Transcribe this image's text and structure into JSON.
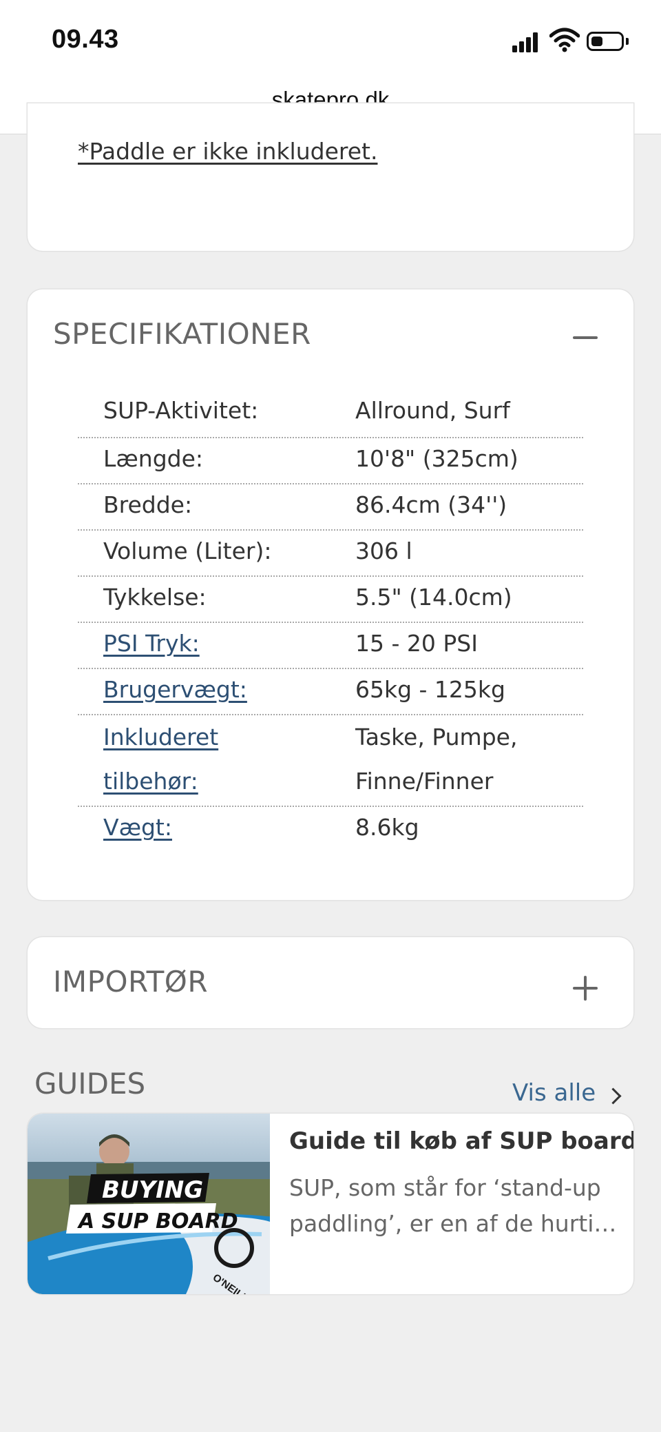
{
  "status_bar": {
    "time": "09.43"
  },
  "browser": {
    "url": "skatepro.dk"
  },
  "note": {
    "text": "*Paddle er ikke inkluderet."
  },
  "specs": {
    "title": "SPECIFIKATIONER",
    "rows": [
      {
        "label": "SUP-Aktivitet:",
        "value": "Allround, Surf",
        "link": false
      },
      {
        "label": "Længde:",
        "value": "10'8\" (325cm)",
        "link": false
      },
      {
        "label": "Bredde:",
        "value": "86.4cm (34'')",
        "link": false
      },
      {
        "label": "Volume (Liter):",
        "value": "306 l",
        "link": false
      },
      {
        "label": "Tykkelse:",
        "value": "5.5\" (14.0cm)",
        "link": false
      },
      {
        "label": "PSI Tryk:",
        "value": "15 - 20 PSI",
        "link": true
      },
      {
        "label": "Brugervægt:",
        "value": "65kg - 125kg",
        "link": true
      },
      {
        "label_lines": [
          "Inkluderet",
          "tilbehør:"
        ],
        "value_lines": [
          "Taske, Pumpe,",
          "Finne/Finner"
        ],
        "link": true
      },
      {
        "label": "Vægt:",
        "value": "8.6kg",
        "link": true
      }
    ]
  },
  "importer": {
    "title": "IMPORTØR"
  },
  "guides": {
    "title": "GUIDES",
    "see_all": "Vis alle",
    "items": [
      {
        "thumbnail_text": [
          "BUYING",
          "A SUP BOARD"
        ],
        "board_brand": "O'NEILL",
        "title": "Guide til køb af SUP board",
        "excerpt_lines": [
          "SUP, som står for ‘stand-up",
          "paddling’, er en af de hurtigst voksende"
        ]
      }
    ]
  }
}
